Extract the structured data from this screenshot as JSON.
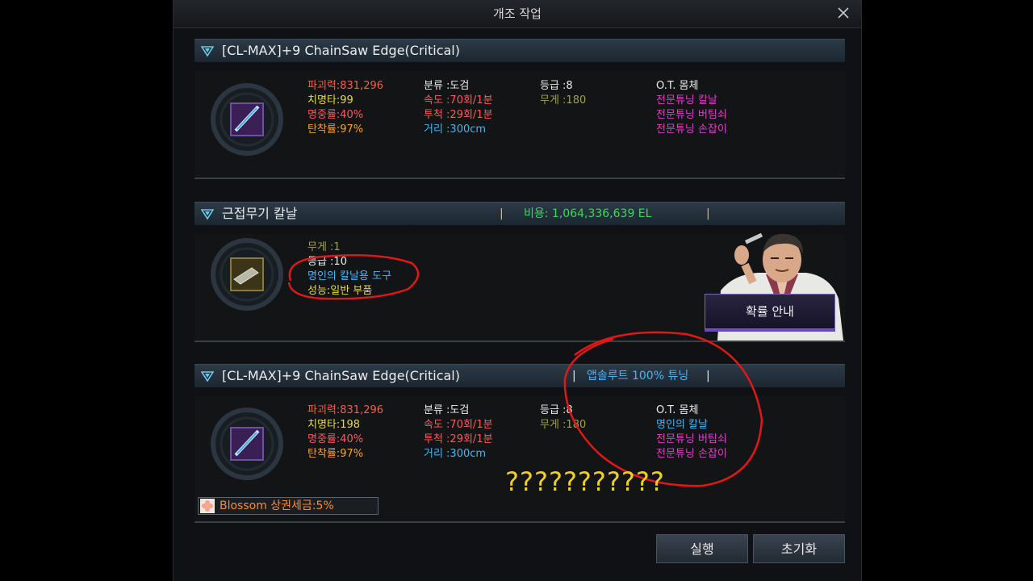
{
  "dialog": {
    "title": "개조 작업"
  },
  "item1": {
    "name": "[CL-MAX]+9 ChainSaw Edge(Critical)",
    "col1": [
      "파괴력:831,296",
      "치명타:99",
      "명중률:40%",
      "탄착률:97%"
    ],
    "col2": [
      "분류 :도검",
      "속도 :70회/1분",
      "투척 :29회/1분",
      "거리 :300cm"
    ],
    "col3": [
      "등급 :8",
      "무게 :180"
    ],
    "col4": [
      "O.T. 몸체",
      "전문튜닝 칼날",
      "전문튜닝 버팀쇠",
      "전문튜닝 손잡이"
    ]
  },
  "material": {
    "name": "근접무기 칼날",
    "cost": "비용: 1,064,336,639 EL",
    "lines": [
      "무게 :1",
      "등급 :10",
      "명인의 칼날용 도구",
      "성능:일반 부품"
    ],
    "guide_button": "확률 안내"
  },
  "result": {
    "name": "[CL-MAX]+9 ChainSaw Edge(Critical)",
    "tuning": "앱솔루트 100% 튜닝",
    "col1": [
      "파괴력:831,296",
      "치명타:198",
      "명중률:40%",
      "탄착률:97%"
    ],
    "col2": [
      "분류 :도검",
      "속도 :70회/1분",
      "투척 :29회/1분",
      "거리 :300cm"
    ],
    "col3": [
      "등급 :8",
      "무게 :180"
    ],
    "col4": [
      "O.T. 몸체",
      "명인의 칼날",
      "전문튜닝 버팀쇠",
      "전문튜닝 손잡이"
    ],
    "buff": "Blossom 상권세금:5%"
  },
  "annotation": {
    "question_marks": "???????????"
  },
  "buttons": {
    "execute": "실행",
    "reset": "초기화"
  },
  "colors": {
    "orange": "#f0604c",
    "yellow": "#e8d84a",
    "pink": "#ff5a5a",
    "amber": "#ffa030",
    "olive": "#a0a050",
    "blue": "#4ab4f0",
    "magenta": "#e040c8",
    "green": "#3cd85a",
    "annotation_red": "#e01818",
    "question_yellow": "#f0d020"
  }
}
